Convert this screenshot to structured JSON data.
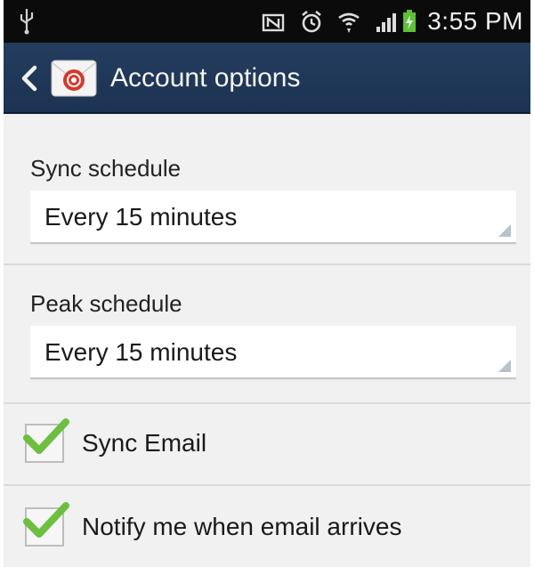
{
  "statusbar": {
    "time": "3:55 PM",
    "icons": [
      "usb-icon",
      "nfc-icon",
      "alarm-icon",
      "wifi-icon",
      "signal-icon",
      "battery-charging-icon"
    ]
  },
  "actionbar": {
    "title": "Account options",
    "icon": "email-app-icon"
  },
  "settings": {
    "sync_schedule": {
      "label": "Sync schedule",
      "value": "Every 15 minutes"
    },
    "peak_schedule": {
      "label": "Peak schedule",
      "value": "Every 15 minutes"
    },
    "sync_email": {
      "label": "Sync Email",
      "checked": true
    },
    "notify": {
      "label": "Notify me when email arrives",
      "checked": true
    }
  },
  "colors": {
    "actionbar": "#1f3656",
    "statusbar": "#0b0b0b",
    "check_green": "#6cbf3f",
    "background": "#f1f1f1"
  }
}
